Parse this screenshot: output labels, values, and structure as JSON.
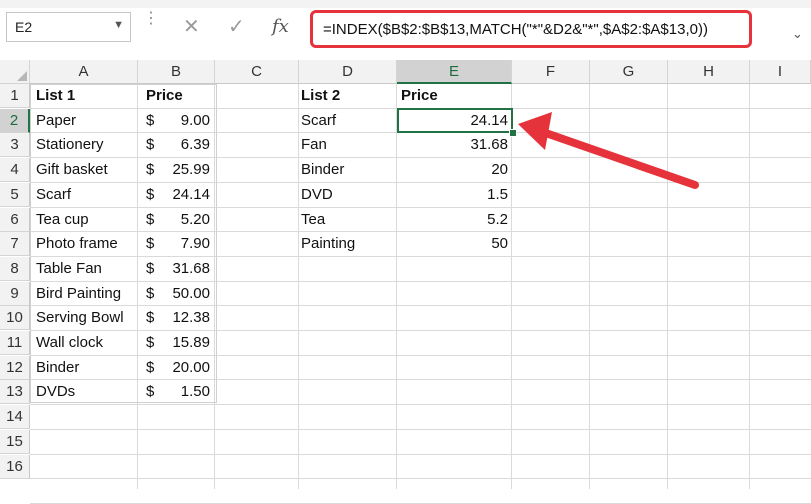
{
  "name_box": "E2",
  "formula": "=INDEX($B$2:$B$13,MATCH(\"*\"&D2&\"*\",$A$2:$A$13,0))",
  "fx_label": "fx",
  "columns": [
    "A",
    "B",
    "C",
    "D",
    "E",
    "F",
    "G",
    "H",
    "I"
  ],
  "selected_column": "E",
  "rows": [
    "1",
    "2",
    "3",
    "4",
    "5",
    "6",
    "7",
    "8",
    "9",
    "10",
    "11",
    "12",
    "13",
    "14",
    "15",
    "16"
  ],
  "selected_row": "2",
  "list1": {
    "header_name": "List 1",
    "header_price": "Price",
    "items": [
      {
        "name": "Paper",
        "cur": "$",
        "price": "9.00"
      },
      {
        "name": "Stationery",
        "cur": "$",
        "price": "6.39"
      },
      {
        "name": "Gift basket",
        "cur": "$",
        "price": "25.99"
      },
      {
        "name": "Scarf",
        "cur": "$",
        "price": "24.14"
      },
      {
        "name": "Tea cup",
        "cur": "$",
        "price": "5.20"
      },
      {
        "name": "Photo frame",
        "cur": "$",
        "price": "7.90"
      },
      {
        "name": "Table Fan",
        "cur": "$",
        "price": "31.68"
      },
      {
        "name": "Bird Painting",
        "cur": "$",
        "price": "50.00"
      },
      {
        "name": "Serving Bowl",
        "cur": "$",
        "price": "12.38"
      },
      {
        "name": "Wall clock",
        "cur": "$",
        "price": "15.89"
      },
      {
        "name": "Binder",
        "cur": "$",
        "price": "20.00"
      },
      {
        "name": "DVDs",
        "cur": "$",
        "price": "1.50"
      }
    ]
  },
  "list2": {
    "header_name": "List 2",
    "header_price": "Price",
    "items": [
      {
        "name": "Scarf",
        "price": "24.14"
      },
      {
        "name": "Fan",
        "price": "31.68"
      },
      {
        "name": "Binder",
        "price": "20"
      },
      {
        "name": "DVD",
        "price": "1.5"
      },
      {
        "name": "Tea",
        "price": "5.2"
      },
      {
        "name": "Painting",
        "price": "50"
      }
    ]
  },
  "annotation_color": "#e5323b",
  "selection_color": "#217346"
}
